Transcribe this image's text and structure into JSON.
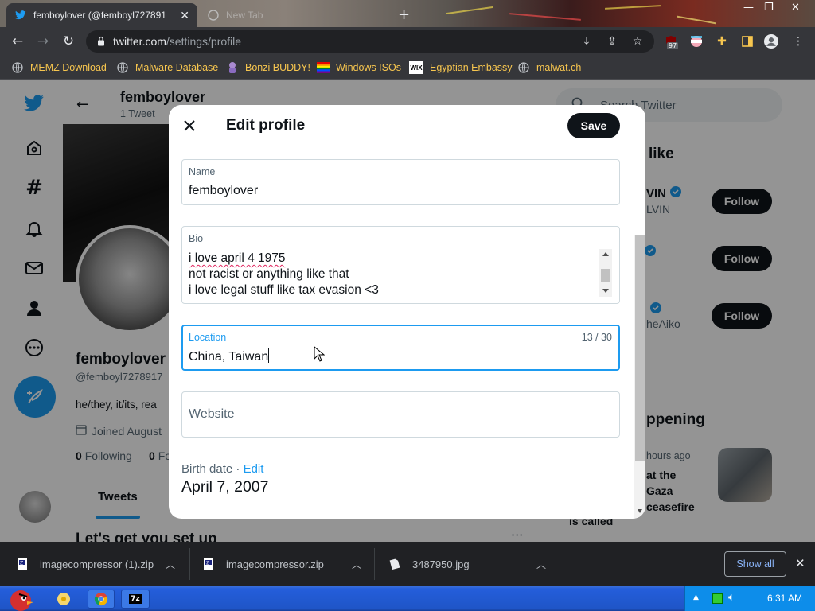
{
  "browser": {
    "tabs": [
      {
        "title": "femboylover (@femboyl727891",
        "active": true
      },
      {
        "title": "New Tab",
        "active": false
      }
    ],
    "url_host": "twitter.com",
    "url_path": "/settings/profile",
    "extension_badge": "97",
    "bookmarks": [
      {
        "label": "MEMZ Download",
        "icon": "globe-icon"
      },
      {
        "label": "Malware Database",
        "icon": "globe-icon"
      },
      {
        "label": "Bonzi BUDDY!",
        "icon": "bonzi-icon"
      },
      {
        "label": "Windows ISOs",
        "icon": "rainbow-flag-icon"
      },
      {
        "label": "Egyptian Embassy",
        "icon": "wix-icon"
      },
      {
        "label": "malwat.ch",
        "icon": "globe-icon"
      }
    ]
  },
  "profile": {
    "display_name": "femboylover",
    "tweet_count": "1 Tweet",
    "handle": "@femboyl7278917",
    "bio_snippet": "he/they, it/its, rea",
    "joined": "Joined August",
    "following_count": "0",
    "following_label": "Following",
    "followers_count": "0",
    "followers_label": "Fo",
    "tab_tweets": "Tweets",
    "setup_text": "Let's get you set up"
  },
  "right_column": {
    "search_placeholder": "Search Twitter",
    "you_might_like": "like",
    "suggestions": [
      {
        "name": "VIN",
        "handle": "LVIN",
        "follow_label": "Follow"
      },
      {
        "name": "",
        "handle": "",
        "follow_label": "Follow"
      },
      {
        "name": "",
        "handle": "heAiko",
        "follow_label": "Follow"
      }
    ],
    "happening_title": "ppening",
    "happening_meta": "hours ago",
    "happening_lines": [
      "at the",
      "Gaza",
      "ceasefire",
      "is called"
    ]
  },
  "modal": {
    "title": "Edit profile",
    "save_label": "Save",
    "name_label": "Name",
    "name_value": "femboylover",
    "bio_label": "Bio",
    "bio_lines": [
      "i love april 4 1975",
      "not racist or anything like that",
      "i love legal stuff like tax evasion <3"
    ],
    "location_label": "Location",
    "location_value": "China, Taiwan",
    "location_counter": "13 / 30",
    "website_placeholder": "Website",
    "birth_label": "Birth date",
    "birth_sep": " · ",
    "birth_edit": "Edit",
    "birth_value": "April 7, 2007"
  },
  "downloads": {
    "items": [
      {
        "name": "imagecompressor (1).zip"
      },
      {
        "name": "imagecompressor.zip"
      },
      {
        "name": "3487950.jpg"
      }
    ],
    "show_all": "Show all"
  },
  "taskbar": {
    "clock": "6:31 AM"
  },
  "colors": {
    "twitter_blue": "#1d9bf0",
    "chrome_dark": "#35363a",
    "bookmark_text": "#f7c64f",
    "taskbar_blue": "#245edb"
  }
}
